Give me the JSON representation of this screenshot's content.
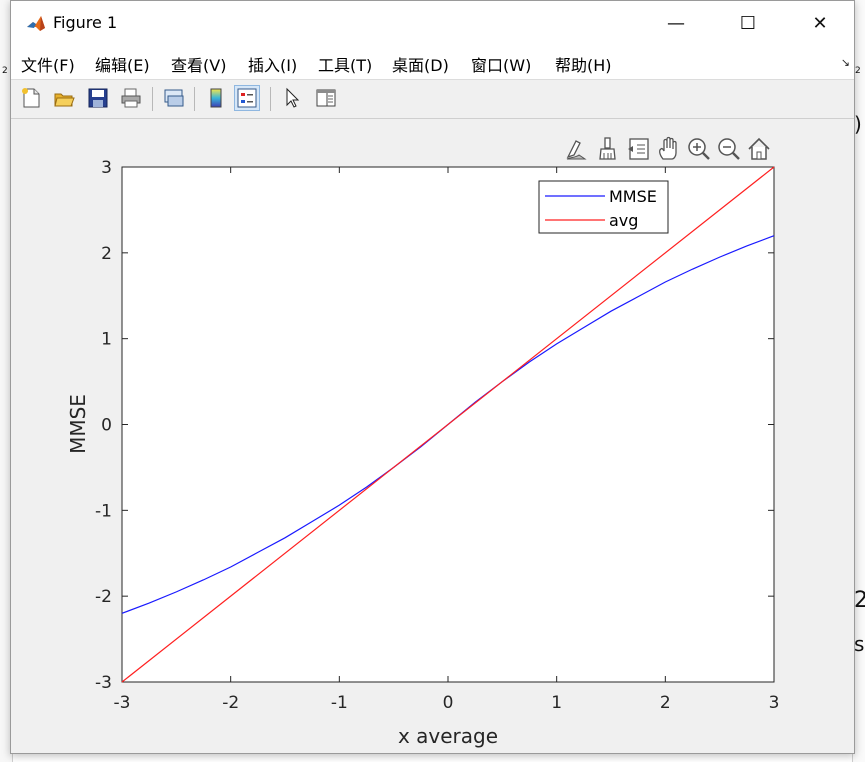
{
  "window": {
    "title": "Figure 1"
  },
  "titlebar": {
    "minimize": "—",
    "maximize": "☐",
    "close": "✕"
  },
  "menu": [
    "文件(F)",
    "编辑(E)",
    "查看(V)",
    "插入(I)",
    "工具(T)",
    "桌面(D)",
    "窗口(W)",
    "帮助(H)"
  ],
  "menu_corner": "↘",
  "background_text": {
    "left_a": "2",
    "left_b": "2",
    "right_a": ")",
    "right_b": "2",
    "right_c": "s"
  },
  "toolbar_icons": [
    "new-figure-icon",
    "open-file-icon",
    "save-icon",
    "print-icon",
    "link-plot-icon",
    "colorbar-icon",
    "legend-icon",
    "pointer-icon",
    "property-inspector-icon"
  ],
  "axes_toolbar_icons": [
    "brush-data-icon",
    "data-tips-icon",
    "pan-icon",
    "zoom-in-icon",
    "zoom-out-icon",
    "home-icon"
  ],
  "colors": {
    "mmse": "#1a1aff",
    "avg": "#ff2020",
    "window_bg": "#f0f0f0"
  },
  "chart_data": {
    "type": "line",
    "title": "",
    "xlabel": "x average",
    "ylabel": "MMSE",
    "xlim": [
      -3,
      3
    ],
    "ylim": [
      -3,
      3
    ],
    "xticks": [
      -3,
      -2,
      -1,
      0,
      1,
      2,
      3
    ],
    "yticks": [
      -3,
      -2,
      -1,
      0,
      1,
      2,
      3
    ],
    "tick_labels_x": [
      "-3",
      "-2",
      "-1",
      "0",
      "1",
      "2",
      "3"
    ],
    "tick_labels_y": [
      "-3",
      "-2",
      "-1",
      "0",
      "1",
      "2",
      "3"
    ],
    "grid": false,
    "legend_position": "top-right",
    "series": [
      {
        "name": "MMSE",
        "color": "#1a1aff",
        "x": [
          -3,
          -2.75,
          -2.5,
          -2.25,
          -2,
          -1.75,
          -1.5,
          -1.25,
          -1,
          -0.75,
          -0.5,
          -0.25,
          0,
          0.25,
          0.5,
          0.75,
          1,
          1.25,
          1.5,
          1.75,
          2,
          2.25,
          2.5,
          2.75,
          3
        ],
        "y": [
          -2.2,
          -2.08,
          -1.95,
          -1.81,
          -1.66,
          -1.49,
          -1.32,
          -1.13,
          -0.94,
          -0.73,
          -0.5,
          -0.26,
          0,
          0.26,
          0.5,
          0.73,
          0.94,
          1.13,
          1.32,
          1.49,
          1.66,
          1.81,
          1.95,
          2.08,
          2.2
        ]
      },
      {
        "name": "avg",
        "color": "#ff2020",
        "x": [
          -3,
          3
        ],
        "y": [
          -3,
          3
        ]
      }
    ]
  }
}
